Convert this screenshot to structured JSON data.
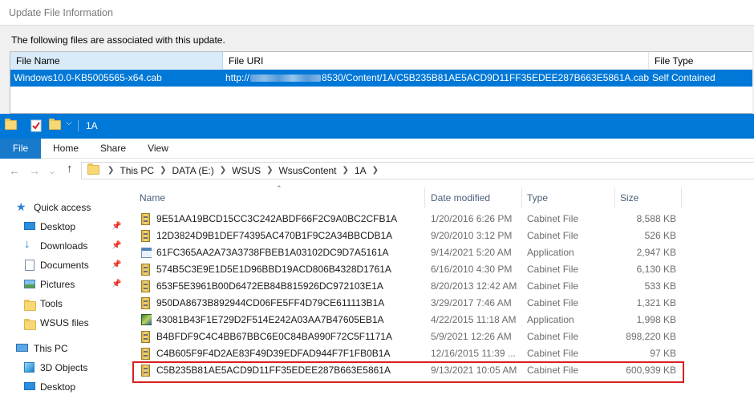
{
  "dialog": {
    "title": "Update File Information",
    "caption": "The following files are associated with this update.",
    "columns": {
      "name": "File Name",
      "uri": "File URI",
      "type": "File Type"
    },
    "row": {
      "name": "Windows10.0-KB5005565-x64.cab",
      "uri_prefix": "http://",
      "uri_suffix": "8530/Content/1A/C5B235B81AE5ACD9D11FF35EDEE287B663E5861A.cab",
      "type": "Self Contained"
    }
  },
  "explorer": {
    "window_title": "1A",
    "ribbon_tabs": {
      "file": "File",
      "home": "Home",
      "share": "Share",
      "view": "View"
    },
    "breadcrumb": [
      "This PC",
      "DATA (E:)",
      "WSUS",
      "WsusContent",
      "1A"
    ],
    "columns": {
      "name": "Name",
      "date": "Date modified",
      "type": "Type",
      "size": "Size"
    },
    "nav": {
      "quick_access": "Quick access",
      "desktop": "Desktop",
      "downloads": "Downloads",
      "documents": "Documents",
      "pictures": "Pictures",
      "tools": "Tools",
      "wsus_files": "WSUS files",
      "this_pc": "This PC",
      "objects_3d": "3D Objects",
      "desktop2": "Desktop"
    },
    "files": [
      {
        "name": "9E51AA19BCD15CC3C242ABDF66F2C9A0BC2CFB1A",
        "date": "1/20/2016 6:26 PM",
        "type": "Cabinet File",
        "size": "8,588 KB",
        "icon": "cab-icon"
      },
      {
        "name": "12D3824D9B1DEF74395AC470B1F9C2A34BBCDB1A",
        "date": "9/20/2010 3:12 PM",
        "type": "Cabinet File",
        "size": "526 KB",
        "icon": "cab-icon"
      },
      {
        "name": "61FC365AA2A73A3738FBEB1A03102DC9D7A5161A",
        "date": "9/14/2021 5:20 AM",
        "type": "Application",
        "size": "2,947 KB",
        "icon": "application-icon"
      },
      {
        "name": "574B5C3E9E1D5E1D96BBD19ACD806B4328D1761A",
        "date": "6/16/2010 4:30 PM",
        "type": "Cabinet File",
        "size": "6,130 KB",
        "icon": "cab-icon"
      },
      {
        "name": "653F5E3961B00D6472EB84B815926DC972103E1A",
        "date": "8/20/2013 12:42 AM",
        "type": "Cabinet File",
        "size": "533 KB",
        "icon": "cab-icon"
      },
      {
        "name": "950DA8673B892944CD06FE5FF4D79CE611113B1A",
        "date": "3/29/2017 7:46 AM",
        "type": "Cabinet File",
        "size": "1,321 KB",
        "icon": "cab-icon"
      },
      {
        "name": "43081B43F1E729D2F514E242A03AA7B47605EB1A",
        "date": "4/22/2015 11:18 AM",
        "type": "Application",
        "size": "1,998 KB",
        "icon": "installer-icon"
      },
      {
        "name": "B4BFDF9C4C4BB67BBC6E0C84BA990F72C5F1171A",
        "date": "5/9/2021 12:26 AM",
        "type": "Cabinet File",
        "size": "898,220 KB",
        "icon": "cab-icon"
      },
      {
        "name": "C4B605F9F4D2AE83F49D39EDFAD944F7F1FB0B1A",
        "date": "12/16/2015 11:39 ...",
        "type": "Cabinet File",
        "size": "97 KB",
        "icon": "cab-icon"
      },
      {
        "name": "C5B235B81AE5ACD9D11FF35EDEE287B663E5861A",
        "date": "9/13/2021 10:05 AM",
        "type": "Cabinet File",
        "size": "600,939 KB",
        "icon": "cab-icon",
        "highlighted": true
      }
    ],
    "accent_color": "#0078d7",
    "highlight_color": "#d62020"
  }
}
